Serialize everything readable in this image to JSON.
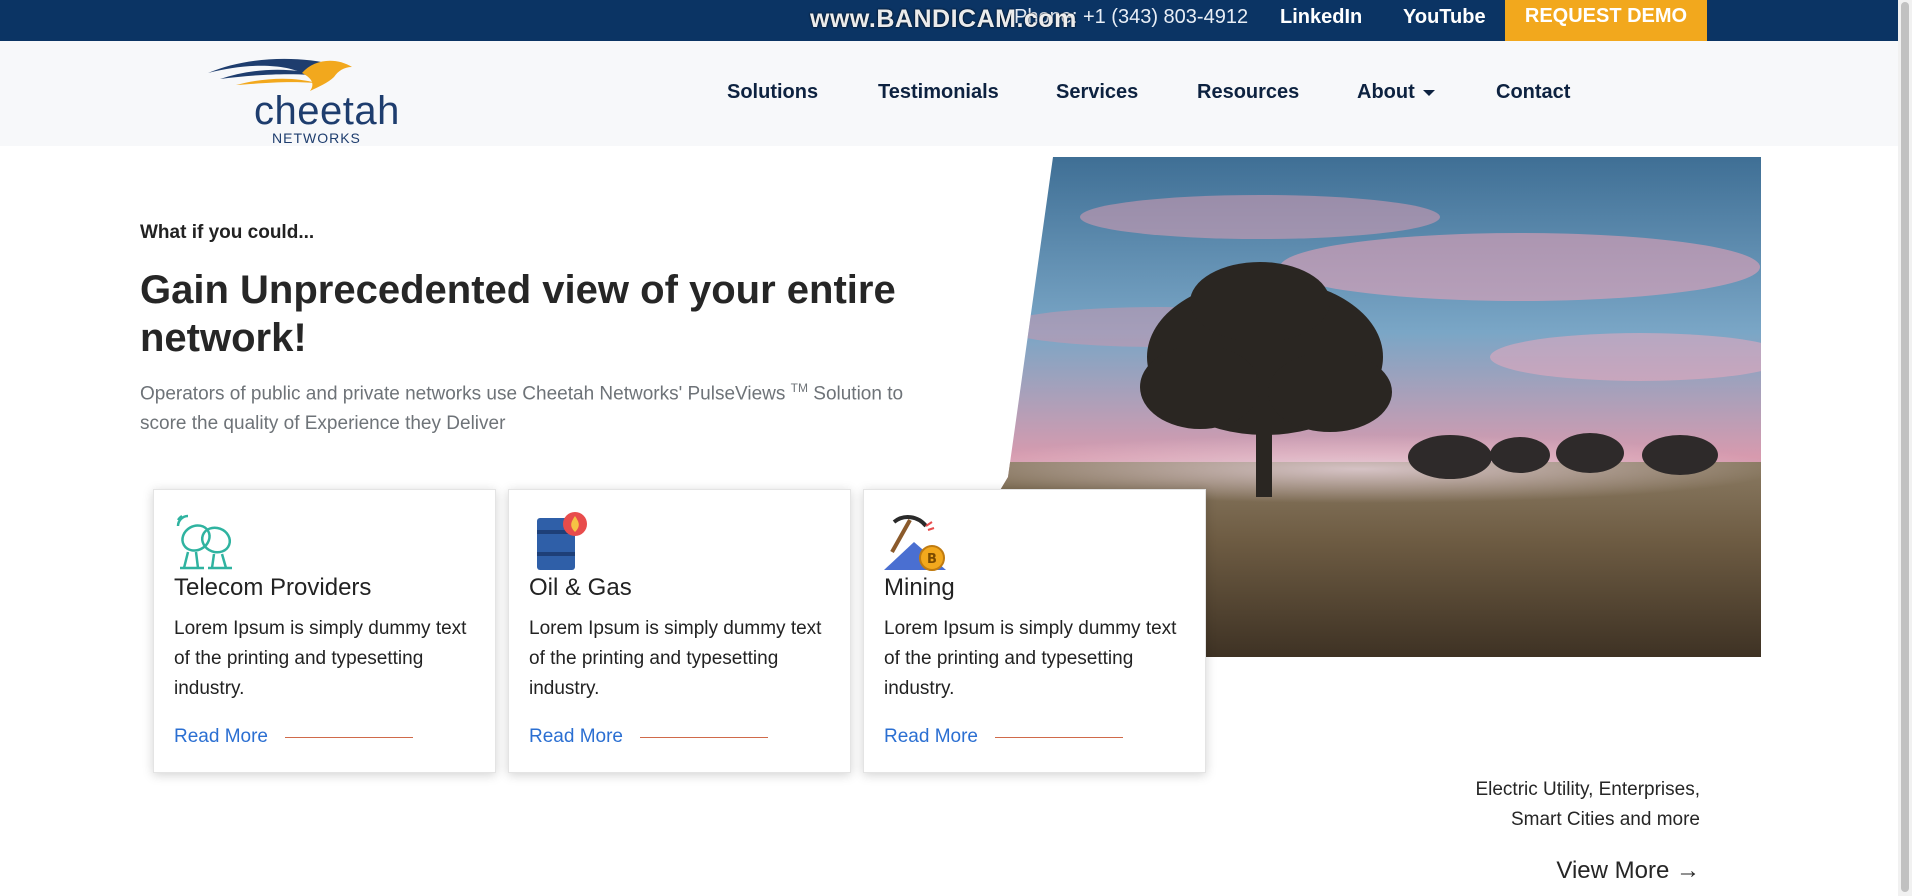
{
  "topbar": {
    "watermark": "www.BANDICAM.com",
    "phone": "Phone: +1 (343) 803-4912",
    "linkedin": "LinkedIn",
    "youtube": "YouTube",
    "demo": "REQUEST DEMO"
  },
  "logo": {
    "brand": "cheetah",
    "sub": "NETWORKS"
  },
  "nav": {
    "solutions": "Solutions",
    "testimonials": "Testimonials",
    "services": "Services",
    "resources": "Resources",
    "about": "About",
    "contact": "Contact"
  },
  "hero": {
    "eyebrow": "What if you could...",
    "headline": "Gain Unprecedented view of your entire network!",
    "sub_pre": "Operators of public and private networks use Cheetah Networks' PulseViews ",
    "sub_tm": "TM",
    "sub_post": " Solution to score the quality of Experience they Deliver"
  },
  "cards": [
    {
      "title": "Telecom Providers",
      "desc": "Lorem Ipsum is simply dummy text of the printing and typesetting industry.",
      "link": "Read More",
      "icon": "satellite-dish-icon"
    },
    {
      "title": "Oil & Gas",
      "desc": "Lorem Ipsum is simply dummy text of the printing and typesetting industry.",
      "link": "Read More",
      "icon": "oil-barrel-icon"
    },
    {
      "title": "Mining",
      "desc": "Lorem Ipsum is simply dummy text of the printing and typesetting industry.",
      "link": "Read More",
      "icon": "pickaxe-bitcoin-icon"
    }
  ],
  "other": {
    "line1": "Electric Utility, Enterprises,",
    "line2": "Smart Cities and more"
  },
  "viewmore": "View More →",
  "colors": {
    "topbar": "#0b3464",
    "demo": "#f2a81d",
    "link": "#2b6fd2",
    "rule": "#d06a4a"
  }
}
